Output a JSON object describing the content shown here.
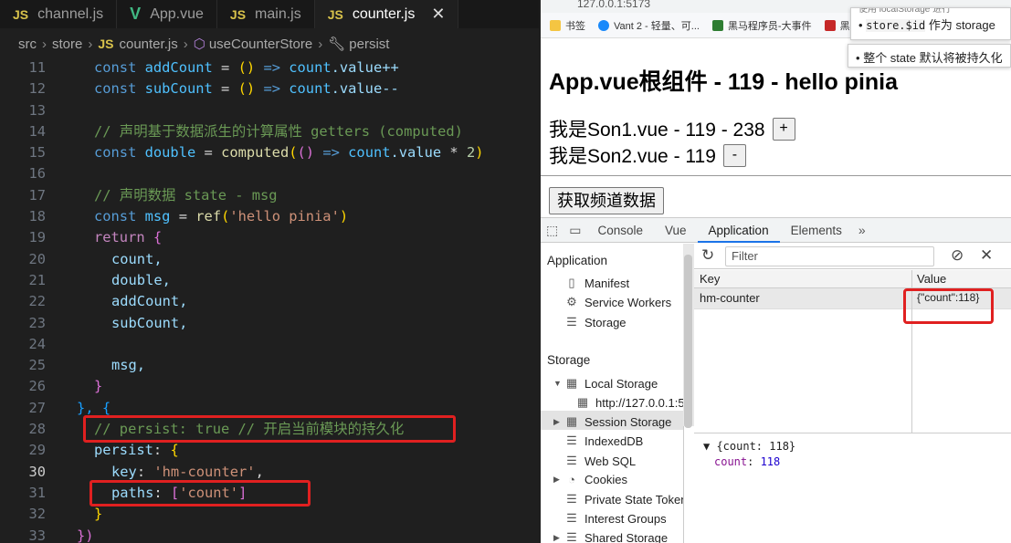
{
  "editor": {
    "tabs": [
      {
        "badge": "JS",
        "label": "channel.js"
      },
      {
        "badge": "V",
        "label": "App.vue"
      },
      {
        "badge": "JS",
        "label": "main.js"
      },
      {
        "badge": "JS",
        "label": "counter.js",
        "close": "✕"
      }
    ],
    "breadcrumb": {
      "p1": "src",
      "p2": "store",
      "badge": "JS",
      "p3": "counter.js",
      "p4": "useCounterStore",
      "p5": "persist"
    },
    "current_line": 30,
    "lines": [
      {
        "n": "11"
      },
      {
        "n": "12"
      },
      {
        "n": "13"
      },
      {
        "n": "14"
      },
      {
        "n": "15"
      },
      {
        "n": "16"
      },
      {
        "n": "17"
      },
      {
        "n": "18"
      },
      {
        "n": "19"
      },
      {
        "n": "20"
      },
      {
        "n": "21"
      },
      {
        "n": "22"
      },
      {
        "n": "23"
      },
      {
        "n": "24"
      },
      {
        "n": "25"
      },
      {
        "n": "26"
      },
      {
        "n": "27"
      },
      {
        "n": "28"
      },
      {
        "n": "29"
      },
      {
        "n": "30"
      },
      {
        "n": "31"
      },
      {
        "n": "32"
      },
      {
        "n": "33"
      }
    ],
    "code": {
      "l11": {
        "kw": "const",
        "name": "addCount",
        "eq": "=",
        "p": "()",
        "arrow": "=>",
        "body": "count",
        "rest": ".value++"
      },
      "l12": {
        "kw": "const",
        "name": "subCount",
        "eq": "=",
        "p": "()",
        "arrow": "=>",
        "body": "count",
        "rest": ".value--"
      },
      "l14": {
        "comment": "// 声明基于数据派生的计算属性 getters (computed)"
      },
      "l15": {
        "kw": "const",
        "name": "double",
        "eq": "=",
        "fn": "computed",
        "arrow": "=>",
        "body": "count",
        "rest": ".value",
        "op": "*",
        "num": "2"
      },
      "l17": {
        "comment": "// 声明数据 state - msg"
      },
      "l18": {
        "kw": "const",
        "name": "msg",
        "eq": "=",
        "fn": "ref",
        "str": "'hello pinia'"
      },
      "l19": {
        "kw": "return",
        "brace": "{"
      },
      "l20": {
        "text": "count,"
      },
      "l21": {
        "text": "double,"
      },
      "l22": {
        "text": "addCount,"
      },
      "l23": {
        "text": "subCount,"
      },
      "l25": {
        "text": "msg,"
      },
      "l26": {
        "text": "}"
      },
      "l27": {
        "text": "},",
        "brace": "{"
      },
      "l28": {
        "comment": "// persist: true // 开启当前模块的持久化"
      },
      "l29": {
        "prop": "persist",
        "colon": ":",
        "brace": "{"
      },
      "l30": {
        "prop": "key",
        "colon": ":",
        "str": "'hm-counter'",
        "comma": ","
      },
      "l31": {
        "prop": "paths",
        "colon": ":",
        "open": "[",
        "str": "'count'",
        "close": "]"
      },
      "l32": {
        "text": "}"
      },
      "l33": {
        "text": "})"
      }
    }
  },
  "browser": {
    "url": "127.0.0.1:5173",
    "bookmarks": [
      "书签",
      "Vant 2 - 轻量、可...",
      "黑马程序员-大事件",
      "黑"
    ],
    "tooltip1": {
      "bullet": "•",
      "code": "store.$id",
      "text": " 作为 storage"
    },
    "tooltip1_top": "使用 localStorage 进行",
    "tooltip2": {
      "bullet": "•",
      "text": "整个 state 默认将被持久化"
    },
    "page": {
      "title": "App.vue根组件 - 119 - hello pinia",
      "son1": "我是Son1.vue - 119 - 238",
      "son1_btn": "+",
      "son2": "我是Son2.vue - 119",
      "son2_btn": "-",
      "fetch_btn": "获取频道数据"
    }
  },
  "devtools": {
    "tabs": [
      "Console",
      "Vue",
      "Application",
      "Elements"
    ],
    "more": "»",
    "active_tab": "Application",
    "sidebar": {
      "h1": "Application",
      "app_items": [
        "Manifest",
        "Service Workers",
        "Storage"
      ],
      "h2": "Storage",
      "local_storage": "Local Storage",
      "local_origin": "http://127.0.0.1:5",
      "session_storage": "Session Storage",
      "indexeddb": "IndexedDB",
      "websql": "Web SQL",
      "cookies": "Cookies",
      "private_state": "Private State Tokens",
      "interest_groups": "Interest Groups",
      "shared_storage": "Shared Storage"
    },
    "filter_placeholder": "Filter",
    "table": {
      "col_key": "Key",
      "col_value": "Value",
      "row_key": "hm-counter",
      "row_value": "{\"count\":118}"
    },
    "preview": {
      "line1": "▼ {count: 118}",
      "key": "count",
      "sep": ": ",
      "val": "118"
    }
  }
}
